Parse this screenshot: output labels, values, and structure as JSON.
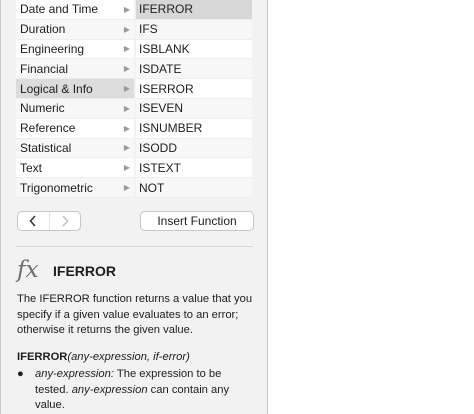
{
  "categories": [
    {
      "label": "Date and Time"
    },
    {
      "label": "Duration"
    },
    {
      "label": "Engineering"
    },
    {
      "label": "Financial"
    },
    {
      "label": "Logical & Info"
    },
    {
      "label": "Numeric"
    },
    {
      "label": "Reference"
    },
    {
      "label": "Statistical"
    },
    {
      "label": "Text"
    },
    {
      "label": "Trigonometric"
    }
  ],
  "functions": [
    {
      "label": "IFERROR"
    },
    {
      "label": "IFS"
    },
    {
      "label": "ISBLANK"
    },
    {
      "label": "ISDATE"
    },
    {
      "label": "ISERROR"
    },
    {
      "label": "ISEVEN"
    },
    {
      "label": "ISNUMBER"
    },
    {
      "label": "ISODD"
    },
    {
      "label": "ISTEXT"
    },
    {
      "label": "NOT"
    }
  ],
  "toolbar": {
    "back_icon": "chevron-left-icon",
    "forward_icon": "chevron-right-icon",
    "insert_label": "Insert Function"
  },
  "help": {
    "fx_icon": "fx",
    "title": "IFERROR",
    "description": "The IFERROR function returns a value that you specify if a given value evaluates to an error; otherwise it returns the given value.",
    "syntax_name": "IFERROR",
    "syntax_args": "(any-expression, if-error)",
    "bullet_term": "any-expression:",
    "bullet_text_1": " The expression to be tested. ",
    "bullet_term_2": "any-expression",
    "bullet_text_2": " can contain any value."
  },
  "colors": {
    "panel_bg": "#f2f2f2",
    "selected_row": "#dcdcdc",
    "border": "#c6c6c6"
  }
}
